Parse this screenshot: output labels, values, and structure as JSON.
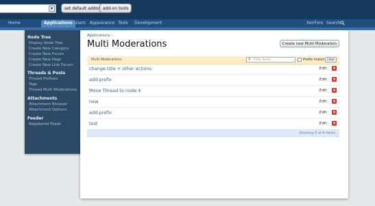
{
  "topbar": {
    "addon_select_value": "",
    "addon_select_arrow": "▾",
    "set_default_label": "set default addon",
    "addon_tools_label": "add-on tools"
  },
  "nav": {
    "tabs": [
      "Home",
      "Applications",
      "Users",
      "Appearance",
      "Tools",
      "Development"
    ],
    "active_tab": "Applications",
    "right_link": "XenForo",
    "search_label": "Search"
  },
  "sidebar": {
    "node_tree": {
      "title": "Node Tree",
      "items": [
        "Display Node Tree",
        "Create New Category",
        "Create New Forum",
        "Create New Page",
        "Create New Link Forum"
      ]
    },
    "threads_posts": {
      "title": "Threads & Posts",
      "items": [
        "Thread Prefixes",
        "Tags",
        "Thread Multi Moderations"
      ]
    },
    "attachments": {
      "title": "Attachments",
      "items": [
        "Attachment Browser",
        "Attachment Options"
      ]
    },
    "feeder": {
      "title": "Feeder",
      "items": [
        "Registered Feeds"
      ]
    }
  },
  "main": {
    "breadcrumb": "Applications ›",
    "title": "Multi Moderations",
    "create_button": "Create new Multi Moderation",
    "list_header": "Multi Moderations",
    "filter_placeholder": "Filter items",
    "prefix_match_label": "Prefix match",
    "clear_label": "clear",
    "rows": [
      {
        "name": "change title + other actions",
        "edit": "Edit"
      },
      {
        "name": "add prefix",
        "edit": "Edit"
      },
      {
        "name": "Move Thread to node 4",
        "edit": "Edit"
      },
      {
        "name": "new",
        "edit": "Edit"
      },
      {
        "name": "add prefix",
        "edit": "Edit"
      },
      {
        "name": "test",
        "edit": "Edit"
      }
    ],
    "delete_glyph": "×",
    "footer_count": "Showing 6 of 6 items"
  },
  "colors": {
    "topbar": "#17395b",
    "navbar": "#1f4f80",
    "active_tab": "#4e86bd",
    "sidebar": "#2c4a66",
    "list_header": "#ffedc4",
    "link": "#2a5f96",
    "delete": "#d9362b"
  }
}
